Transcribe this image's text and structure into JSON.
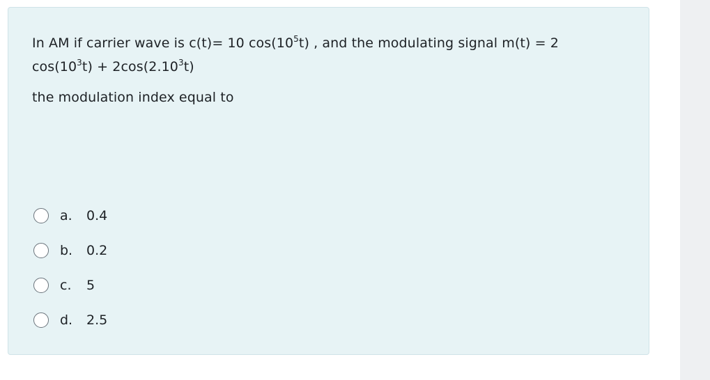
{
  "question": {
    "line1_pre": "In AM  if  carrier wave is c(t)= 10 cos(10",
    "sup1": "5",
    "line1_post": "t) , and the modulating signal m(t) = 2",
    "line2_pre": "cos(10",
    "sup2": "3",
    "line2_mid": "t)  +  2cos(2.10",
    "sup3": "3",
    "line2_post": "t)",
    "prompt": "the modulation index equal to"
  },
  "answers": [
    {
      "letter": "a.",
      "value": "0.4"
    },
    {
      "letter": "b.",
      "value": "0.2"
    },
    {
      "letter": "c.",
      "value": "5"
    },
    {
      "letter": "d.",
      "value": "2.5"
    }
  ]
}
